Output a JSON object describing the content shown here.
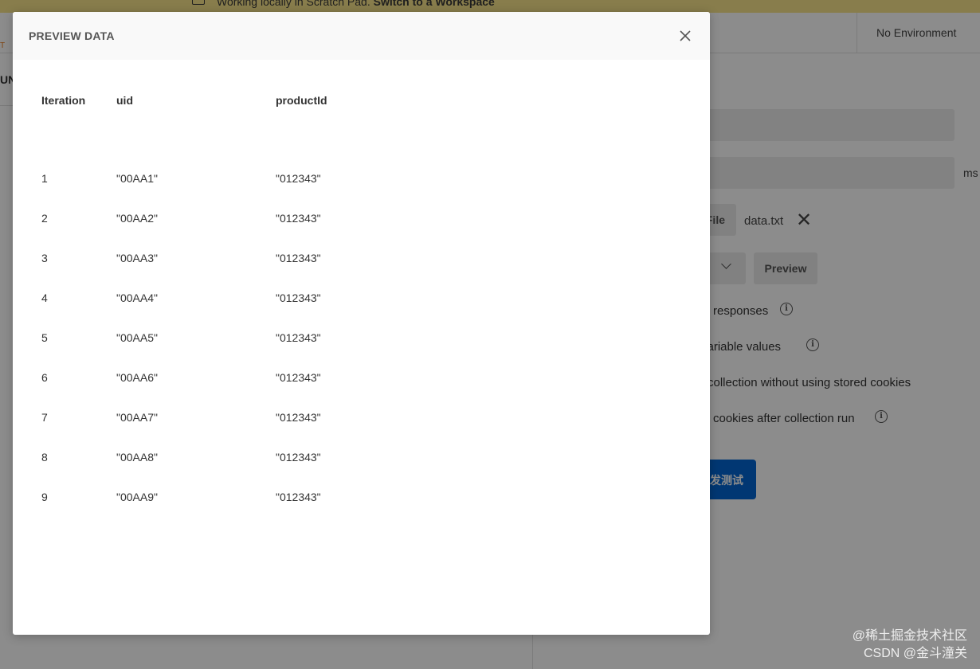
{
  "banner": {
    "text_prefix": "Working locally in Scratch Pad.",
    "link": "Switch to a Workspace"
  },
  "topbar": {
    "tab_fragment": "T",
    "environment": "No Environment"
  },
  "left_panel": {
    "heading_fragment": "UN"
  },
  "runner": {
    "ms_suffix": "ms",
    "file_button": "File",
    "file_name": "data.txt",
    "file_remove_icon": "close-icon",
    "preview_button": "Preview",
    "options": [
      "responses",
      "variable values",
      "collection without using stored cookies",
      "cookies after collection run"
    ],
    "run_button": "发测试"
  },
  "modal": {
    "title": "PREVIEW DATA",
    "close_icon": "close-icon",
    "columns": [
      "Iteration",
      "uid",
      "productId"
    ],
    "rows": [
      [
        "1",
        "\"00AA1\"",
        "\"012343\""
      ],
      [
        "2",
        "\"00AA2\"",
        "\"012343\""
      ],
      [
        "3",
        "\"00AA3\"",
        "\"012343\""
      ],
      [
        "4",
        "\"00AA4\"",
        "\"012343\""
      ],
      [
        "5",
        "\"00AA5\"",
        "\"012343\""
      ],
      [
        "6",
        "\"00AA6\"",
        "\"012343\""
      ],
      [
        "7",
        "\"00AA7\"",
        "\"012343\""
      ],
      [
        "8",
        "\"00AA8\"",
        "\"012343\""
      ],
      [
        "9",
        "\"00AA9\"",
        "\"012343\""
      ]
    ]
  },
  "watermark": {
    "line1": "@稀土掘金技术社区",
    "line2": "CSDN @金斗潼关"
  },
  "colors": {
    "banner": "#f7e38a",
    "primary_button": "#0265d2",
    "overlay": "rgba(0,0,0,0.45)"
  }
}
